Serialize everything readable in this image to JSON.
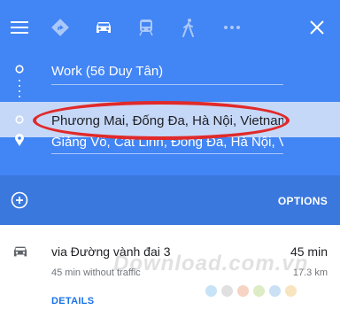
{
  "top_bar": {
    "modes": [
      "menu-icon",
      "best-route-icon",
      "car-icon",
      "transit-icon",
      "walk-icon",
      "more-icon"
    ],
    "close_icon": "close-icon"
  },
  "route": {
    "origin": "Work (56 Duy Tân)",
    "waypoint": "Phương Mai, Đống Đa, Hà Nội, Vietnam",
    "destination": "Giảng Võ, Cát Linh, Đống Đa, Hà Nội, Vi"
  },
  "actions": {
    "options_label": "OPTIONS"
  },
  "result": {
    "via": "via Đường vành đai 3",
    "duration": "45 min",
    "traffic_note": "45 min without traffic",
    "distance": "17.3 km",
    "details_label": "DETAILS"
  },
  "watermark": "Download.com.vn",
  "colors": {
    "panel": "#4285f4",
    "bottom_bar": "#3a78de",
    "highlight": "#c6d8f8",
    "annotation": "#e02a2a"
  }
}
